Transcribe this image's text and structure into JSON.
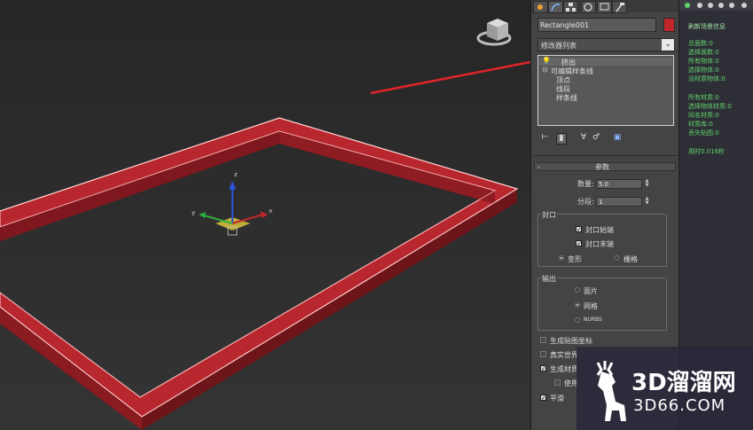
{
  "panel": {
    "object_name": "Rectangle001",
    "object_color": "#c0272d",
    "modifier_list_label": "修改器列表",
    "stack": {
      "extrude": "挤出",
      "editable_spline": "可编辑样条线",
      "vertex": "顶点",
      "segment": "线段",
      "spline": "样条线"
    },
    "parameters": {
      "rollout_toggle": "-",
      "rollout_title": "参数",
      "amount_label": "数量:",
      "amount_value": "5.0",
      "segments_label": "分段:",
      "segments_value": "1",
      "capping_group": "封口",
      "cap_start": "封口始端",
      "cap_end": "封口末端",
      "morph": "变形",
      "grid": "栅格",
      "output_group": "输出",
      "patch": "面片",
      "mesh": "网格",
      "nurbs": "NURBS",
      "gen_map_coords": "生成贴图坐标",
      "real_world": "真实世界",
      "gen_mat_ids": "生成材质",
      "use": "使用",
      "smooth": "平滑"
    }
  },
  "info": {
    "refresh_label": "刷新场景信息",
    "lines_group1": [
      "总面数:0",
      "选择面数:0",
      "所有物体:0",
      "选择物体:0",
      "没材质物体:0"
    ],
    "lines_group2": [
      "所有材质:0",
      "选择物体材质:0",
      "同名材质:0",
      "材质库:0",
      "丢失贴图:0"
    ],
    "time_label": "用时0.016秒"
  },
  "viewport": {
    "gizmo_axes": [
      "x",
      "y",
      "z"
    ],
    "frame_color": "#b8262e",
    "annotation_arrow_color": "#e0242a"
  },
  "watermark": {
    "brand": "3D溜溜网",
    "domain": "3D66.COM"
  },
  "icons": {
    "create_tab": "sun-icon",
    "modify_tab": "curve-icon",
    "hierarchy_tab": "hierarchy-icon",
    "motion_tab": "motion-icon",
    "display_tab": "monitor-icon",
    "utilities_tab": "hammer-icon",
    "viewcube": "viewcube-icon",
    "logo": "deer-logo-icon"
  }
}
